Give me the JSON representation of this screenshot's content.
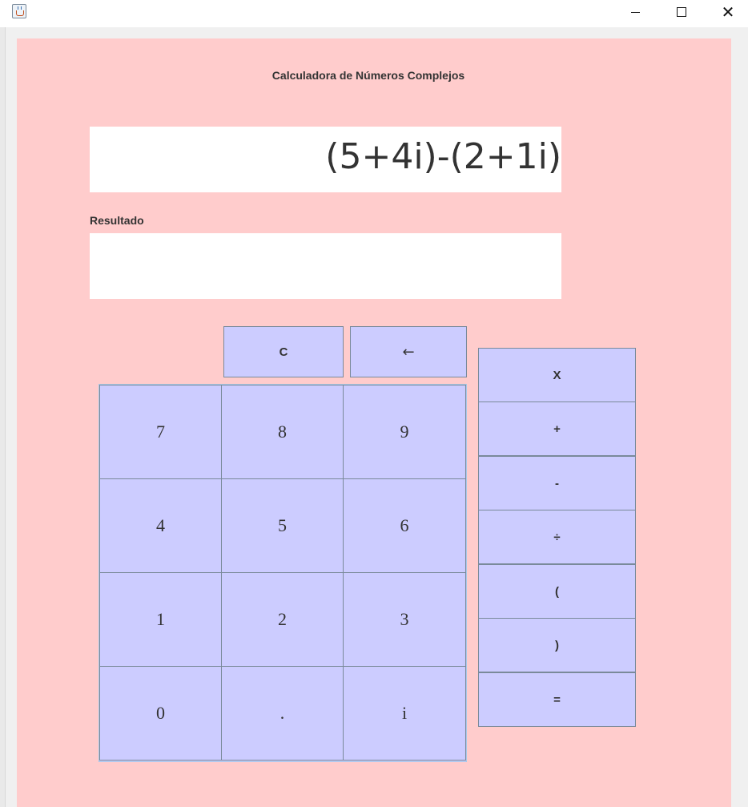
{
  "window": {
    "minimize_icon": "minimize-icon",
    "maximize_icon": "maximize-icon",
    "close_label": "✕"
  },
  "colors": {
    "panel_bg": "#ffcccc",
    "button_bg": "#ccccff",
    "display_bg": "#ffffff",
    "text": "#333333"
  },
  "calculator": {
    "title": "Calculadora de Números Complejos",
    "expression": "(5+4i)-(2+1i)",
    "result_label": "Resultado",
    "result_value": ""
  },
  "controls": {
    "clear": "C",
    "backspace": "←"
  },
  "keypad": [
    [
      "7",
      "8",
      "9"
    ],
    [
      "4",
      "5",
      "6"
    ],
    [
      "1",
      "2",
      "3"
    ],
    [
      "0",
      ".",
      "i"
    ]
  ],
  "operators": [
    "X",
    "+",
    "-",
    "÷",
    "(",
    ")",
    "="
  ]
}
